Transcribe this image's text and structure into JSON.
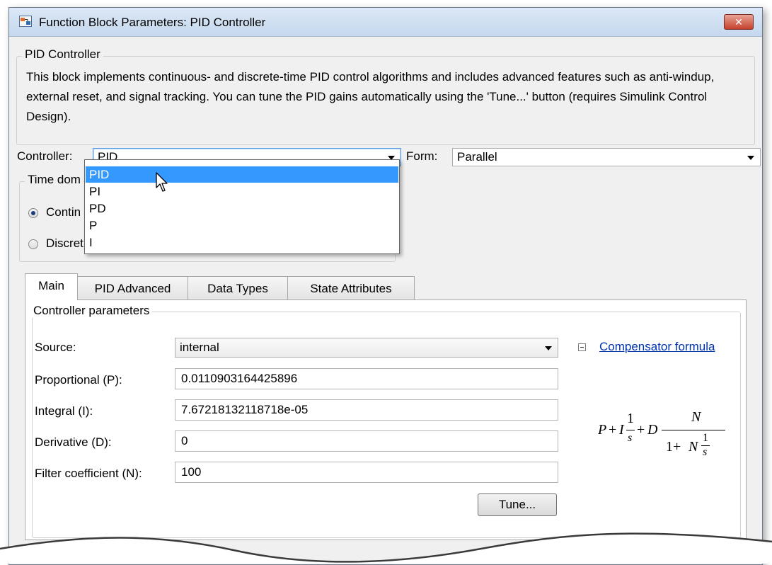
{
  "window": {
    "title": "Function Block Parameters: PID Controller",
    "title_icon": "simulink-block-icon",
    "close_label": "✕"
  },
  "header_group": {
    "legend": "PID Controller",
    "description": "This block implements continuous- and discrete-time PID control algorithms and includes advanced features such as anti-windup, external reset, and signal tracking. You can tune the PID gains automatically using the 'Tune...' button (requires Simulink Control Design)."
  },
  "controller": {
    "label": "Controller:",
    "value": "PID",
    "options": [
      "PID",
      "PI",
      "PD",
      "P",
      "I"
    ],
    "highlighted": "PID"
  },
  "form": {
    "label": "Form:",
    "value": "Parallel"
  },
  "time_domain": {
    "legend": "Time dom",
    "options": [
      {
        "label": "Contin",
        "checked": true
      },
      {
        "label": "Discret",
        "checked": false
      }
    ]
  },
  "tabs": [
    {
      "label": "Main",
      "active": true
    },
    {
      "label": "PID Advanced",
      "active": false
    },
    {
      "label": "Data Types",
      "active": false
    },
    {
      "label": "State Attributes",
      "active": false
    }
  ],
  "controller_parameters": {
    "legend": "Controller parameters",
    "source": {
      "label": "Source:",
      "value": "internal"
    },
    "proportional": {
      "label": "Proportional (P):",
      "value": "0.0110903164425896"
    },
    "integral": {
      "label": "Integral (I):",
      "value": "7.67218132118718e-05"
    },
    "derivative": {
      "label": "Derivative (D):",
      "value": "0"
    },
    "filter": {
      "label": "Filter coefficient (N):",
      "value": "100"
    },
    "compensator_link": "Compensator formula",
    "tune_button": "Tune..."
  },
  "formula": {
    "P": "P",
    "plus1": "+",
    "I": "I",
    "one_a": "1",
    "s_a": "s",
    "plus2": "+",
    "D": "D",
    "N_top": "N",
    "denom_1": "1+",
    "N_bottom": "N",
    "one_b": "1",
    "s_b": "s"
  },
  "colors": {
    "selection": "#3399ff",
    "link": "#0033aa",
    "close_button": "#c5422d"
  }
}
